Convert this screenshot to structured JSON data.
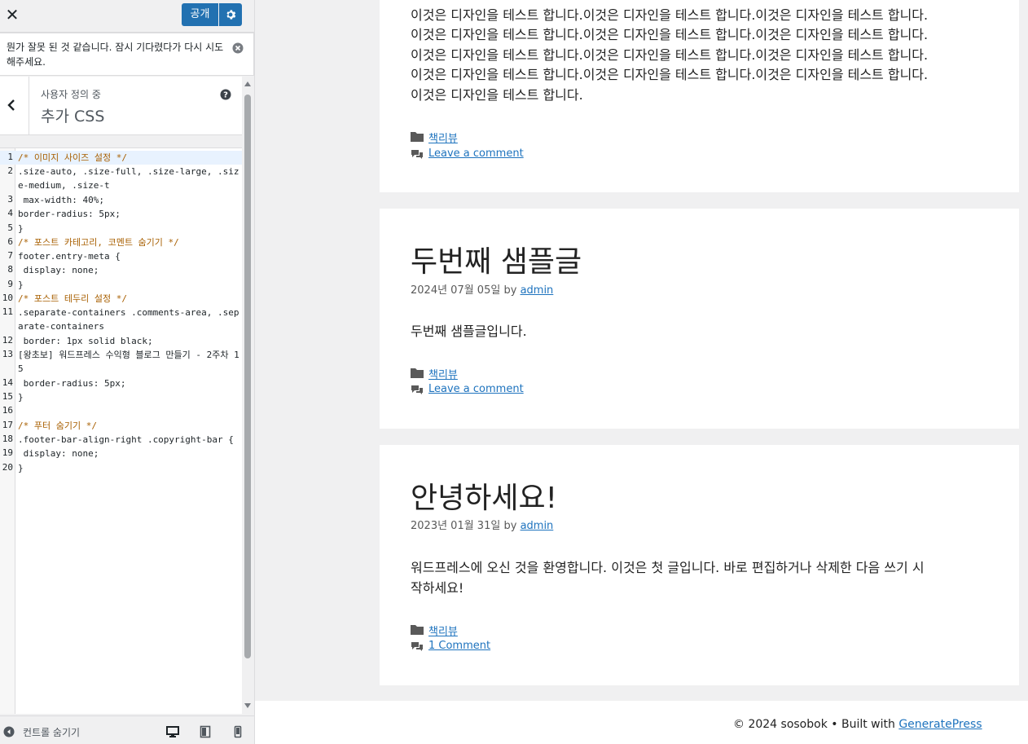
{
  "customizer": {
    "close_label": "✕",
    "publish_label": "공개",
    "notice": "뭔가 잘못 된 것 같습니다. 잠시 기다렸다가 다시 시도해주세요.",
    "section_sub": "사용자 정의 중",
    "section_title": "추가 CSS",
    "footer_label": "컨트롤 숨기기",
    "devices": [
      "desktop-icon",
      "tablet-icon",
      "mobile-icon"
    ]
  },
  "css_lines": [
    {
      "n": "1",
      "text": "/* 이미지 사이즈 설정 */"
    },
    {
      "n": "2",
      "text": ".size-auto, .size-full, .size-large, .size-medium, .size-t"
    },
    {
      "n": "3",
      "text": " max-width: 40%;"
    },
    {
      "n": "4",
      "text": "border-radius: 5px;"
    },
    {
      "n": "5",
      "text": "}"
    },
    {
      "n": "6",
      "text": "/* 포스트 카테고리, 코멘트 숨기기 */"
    },
    {
      "n": "7",
      "text": "footer.entry-meta {"
    },
    {
      "n": "8",
      "text": " display: none;"
    },
    {
      "n": "9",
      "text": "}"
    },
    {
      "n": "10",
      "text": "/* 포스트 테두리 설정 */"
    },
    {
      "n": "11",
      "text": ".separate-containers .comments-area, .separate-containers"
    },
    {
      "n": "12",
      "text": " border: 1px solid black;"
    },
    {
      "n": "13",
      "text": "[왕초보] 워드프레스 수익형 블로그 만들기 - 2주차 15"
    },
    {
      "n": "14",
      "text": " border-radius: 5px;"
    },
    {
      "n": "15",
      "text": "}"
    },
    {
      "n": "16",
      "text": ""
    },
    {
      "n": "17",
      "text": "/* 푸터 숨기기 */"
    },
    {
      "n": "18",
      "text": ".footer-bar-align-right .copyright-bar {"
    },
    {
      "n": "19",
      "text": " display: none;"
    },
    {
      "n": "20",
      "text": "}"
    }
  ],
  "posts": [
    {
      "body_lines": [
        "이것은 디자인을 테스트 합니다.이것은 디자인을 테스트 합니다.이것은 디자인을 테스트 합니다.",
        "이것은 디자인을 테스트 합니다.이것은 디자인을 테스트 합니다.이것은 디자인을 테스트 합니다.",
        "이것은 디자인을 테스트 합니다.이것은 디자인을 테스트 합니다.이것은 디자인을 테스트 합니다.",
        "이것은 디자인을 테스트 합니다.이것은 디자인을 테스트 합니다.이것은 디자인을 테스트 합니다.",
        "이것은 디자인을 테스트 합니다."
      ],
      "category": "책리뷰",
      "comments": "Leave a comment"
    },
    {
      "title": "두번째 샘플글",
      "date": "2024년 07월 05일",
      "by": "by",
      "author": "admin",
      "body": "두번째 샘플글입니다.",
      "category": "책리뷰",
      "comments": "Leave a comment"
    },
    {
      "title": "안녕하세요!",
      "date": "2023년 01월 31일",
      "by": "by",
      "author": "admin",
      "body_lines": [
        "워드프레스에 오신 것을 환영합니다. 이것은 첫 글입니다. 바로 편집하거나 삭제한 다음 쓰기 시",
        "작하세요!"
      ],
      "category": "책리뷰",
      "comments": "1 Comment"
    }
  ],
  "site_footer": {
    "text": "© 2024 sosobok • Built with",
    "link": "GeneratePress"
  }
}
